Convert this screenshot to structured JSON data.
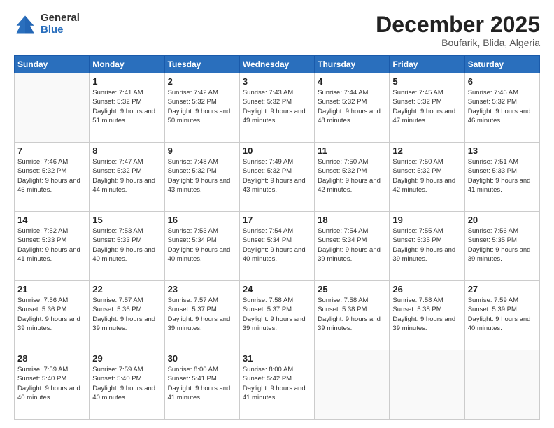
{
  "logo": {
    "general": "General",
    "blue": "Blue"
  },
  "header": {
    "month": "December 2025",
    "location": "Boufarik, Blida, Algeria"
  },
  "weekdays": [
    "Sunday",
    "Monday",
    "Tuesday",
    "Wednesday",
    "Thursday",
    "Friday",
    "Saturday"
  ],
  "weeks": [
    [
      {
        "day": "",
        "sunrise": "",
        "sunset": "",
        "daylight": ""
      },
      {
        "day": "1",
        "sunrise": "Sunrise: 7:41 AM",
        "sunset": "Sunset: 5:32 PM",
        "daylight": "Daylight: 9 hours and 51 minutes."
      },
      {
        "day": "2",
        "sunrise": "Sunrise: 7:42 AM",
        "sunset": "Sunset: 5:32 PM",
        "daylight": "Daylight: 9 hours and 50 minutes."
      },
      {
        "day": "3",
        "sunrise": "Sunrise: 7:43 AM",
        "sunset": "Sunset: 5:32 PM",
        "daylight": "Daylight: 9 hours and 49 minutes."
      },
      {
        "day": "4",
        "sunrise": "Sunrise: 7:44 AM",
        "sunset": "Sunset: 5:32 PM",
        "daylight": "Daylight: 9 hours and 48 minutes."
      },
      {
        "day": "5",
        "sunrise": "Sunrise: 7:45 AM",
        "sunset": "Sunset: 5:32 PM",
        "daylight": "Daylight: 9 hours and 47 minutes."
      },
      {
        "day": "6",
        "sunrise": "Sunrise: 7:46 AM",
        "sunset": "Sunset: 5:32 PM",
        "daylight": "Daylight: 9 hours and 46 minutes."
      }
    ],
    [
      {
        "day": "7",
        "sunrise": "Sunrise: 7:46 AM",
        "sunset": "Sunset: 5:32 PM",
        "daylight": "Daylight: 9 hours and 45 minutes."
      },
      {
        "day": "8",
        "sunrise": "Sunrise: 7:47 AM",
        "sunset": "Sunset: 5:32 PM",
        "daylight": "Daylight: 9 hours and 44 minutes."
      },
      {
        "day": "9",
        "sunrise": "Sunrise: 7:48 AM",
        "sunset": "Sunset: 5:32 PM",
        "daylight": "Daylight: 9 hours and 43 minutes."
      },
      {
        "day": "10",
        "sunrise": "Sunrise: 7:49 AM",
        "sunset": "Sunset: 5:32 PM",
        "daylight": "Daylight: 9 hours and 43 minutes."
      },
      {
        "day": "11",
        "sunrise": "Sunrise: 7:50 AM",
        "sunset": "Sunset: 5:32 PM",
        "daylight": "Daylight: 9 hours and 42 minutes."
      },
      {
        "day": "12",
        "sunrise": "Sunrise: 7:50 AM",
        "sunset": "Sunset: 5:32 PM",
        "daylight": "Daylight: 9 hours and 42 minutes."
      },
      {
        "day": "13",
        "sunrise": "Sunrise: 7:51 AM",
        "sunset": "Sunset: 5:33 PM",
        "daylight": "Daylight: 9 hours and 41 minutes."
      }
    ],
    [
      {
        "day": "14",
        "sunrise": "Sunrise: 7:52 AM",
        "sunset": "Sunset: 5:33 PM",
        "daylight": "Daylight: 9 hours and 41 minutes."
      },
      {
        "day": "15",
        "sunrise": "Sunrise: 7:53 AM",
        "sunset": "Sunset: 5:33 PM",
        "daylight": "Daylight: 9 hours and 40 minutes."
      },
      {
        "day": "16",
        "sunrise": "Sunrise: 7:53 AM",
        "sunset": "Sunset: 5:34 PM",
        "daylight": "Daylight: 9 hours and 40 minutes."
      },
      {
        "day": "17",
        "sunrise": "Sunrise: 7:54 AM",
        "sunset": "Sunset: 5:34 PM",
        "daylight": "Daylight: 9 hours and 40 minutes."
      },
      {
        "day": "18",
        "sunrise": "Sunrise: 7:54 AM",
        "sunset": "Sunset: 5:34 PM",
        "daylight": "Daylight: 9 hours and 39 minutes."
      },
      {
        "day": "19",
        "sunrise": "Sunrise: 7:55 AM",
        "sunset": "Sunset: 5:35 PM",
        "daylight": "Daylight: 9 hours and 39 minutes."
      },
      {
        "day": "20",
        "sunrise": "Sunrise: 7:56 AM",
        "sunset": "Sunset: 5:35 PM",
        "daylight": "Daylight: 9 hours and 39 minutes."
      }
    ],
    [
      {
        "day": "21",
        "sunrise": "Sunrise: 7:56 AM",
        "sunset": "Sunset: 5:36 PM",
        "daylight": "Daylight: 9 hours and 39 minutes."
      },
      {
        "day": "22",
        "sunrise": "Sunrise: 7:57 AM",
        "sunset": "Sunset: 5:36 PM",
        "daylight": "Daylight: 9 hours and 39 minutes."
      },
      {
        "day": "23",
        "sunrise": "Sunrise: 7:57 AM",
        "sunset": "Sunset: 5:37 PM",
        "daylight": "Daylight: 9 hours and 39 minutes."
      },
      {
        "day": "24",
        "sunrise": "Sunrise: 7:58 AM",
        "sunset": "Sunset: 5:37 PM",
        "daylight": "Daylight: 9 hours and 39 minutes."
      },
      {
        "day": "25",
        "sunrise": "Sunrise: 7:58 AM",
        "sunset": "Sunset: 5:38 PM",
        "daylight": "Daylight: 9 hours and 39 minutes."
      },
      {
        "day": "26",
        "sunrise": "Sunrise: 7:58 AM",
        "sunset": "Sunset: 5:38 PM",
        "daylight": "Daylight: 9 hours and 39 minutes."
      },
      {
        "day": "27",
        "sunrise": "Sunrise: 7:59 AM",
        "sunset": "Sunset: 5:39 PM",
        "daylight": "Daylight: 9 hours and 40 minutes."
      }
    ],
    [
      {
        "day": "28",
        "sunrise": "Sunrise: 7:59 AM",
        "sunset": "Sunset: 5:40 PM",
        "daylight": "Daylight: 9 hours and 40 minutes."
      },
      {
        "day": "29",
        "sunrise": "Sunrise: 7:59 AM",
        "sunset": "Sunset: 5:40 PM",
        "daylight": "Daylight: 9 hours and 40 minutes."
      },
      {
        "day": "30",
        "sunrise": "Sunrise: 8:00 AM",
        "sunset": "Sunset: 5:41 PM",
        "daylight": "Daylight: 9 hours and 41 minutes."
      },
      {
        "day": "31",
        "sunrise": "Sunrise: 8:00 AM",
        "sunset": "Sunset: 5:42 PM",
        "daylight": "Daylight: 9 hours and 41 minutes."
      },
      {
        "day": "",
        "sunrise": "",
        "sunset": "",
        "daylight": ""
      },
      {
        "day": "",
        "sunrise": "",
        "sunset": "",
        "daylight": ""
      },
      {
        "day": "",
        "sunrise": "",
        "sunset": "",
        "daylight": ""
      }
    ]
  ]
}
